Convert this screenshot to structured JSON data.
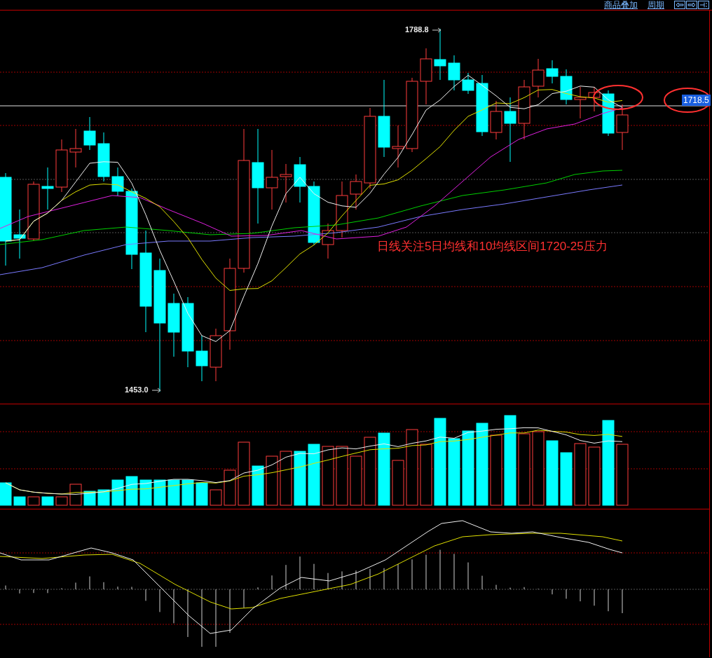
{
  "toolbar": {
    "links": [
      "商品叠加",
      "周期"
    ]
  },
  "main_chart": {
    "high_label": "1788.8",
    "low_label": "1453.0",
    "price_tag": "1718.5",
    "annotation": "日线关注5日均线和10均线区间1720-25压力"
  }
}
